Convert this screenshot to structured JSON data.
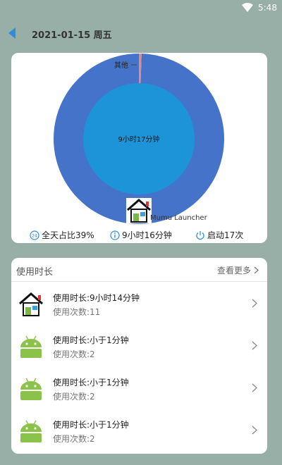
{
  "status_bar": {
    "time": "5:48"
  },
  "header": {
    "date": "2021-01-15 周五"
  },
  "chart": {
    "center_text": "9小时17分钟",
    "other_label": "其他",
    "app_label": "Mumu Launcher",
    "colors": {
      "outer": "#4573c9",
      "inner": "#1e94d8",
      "other": "#e08a88"
    }
  },
  "chart_data": {
    "type": "pie",
    "categories": [
      "Mumu Launcher",
      "其他"
    ],
    "values": [
      99.5,
      0.5
    ]
  },
  "stats": {
    "day_share": "全天占比39%",
    "duration": "9小时16分钟",
    "launches": "启动17次"
  },
  "usage": {
    "title": "使用时长",
    "more": "查看更多",
    "items": [
      {
        "line1": "使用时长:9小时14分钟",
        "line2": "使用次数:11",
        "icon": "house"
      },
      {
        "line1": "使用时长:小于1分钟",
        "line2": "使用次数:2",
        "icon": "android"
      },
      {
        "line1": "使用时长:小于1分钟",
        "line2": "使用次数:2",
        "icon": "android"
      },
      {
        "line1": "使用时长:小于1分钟",
        "line2": "使用次数:2",
        "icon": "android"
      }
    ]
  }
}
